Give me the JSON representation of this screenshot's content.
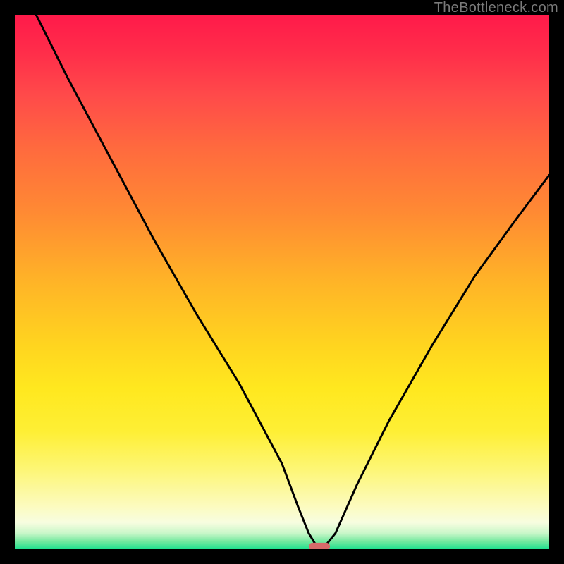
{
  "watermark": "TheBottleneck.com",
  "chart_data": {
    "type": "line",
    "title": "",
    "xlabel": "",
    "ylabel": "",
    "xlim": [
      0,
      100
    ],
    "ylim": [
      0,
      100
    ],
    "grid": false,
    "series": [
      {
        "name": "curve",
        "color": "#000000",
        "x": [
          4,
          10,
          18,
          26,
          34,
          42,
          50,
          53,
          55,
          56.5,
          58,
          60,
          64,
          70,
          78,
          86,
          94,
          100
        ],
        "y": [
          100,
          88,
          73,
          58,
          44,
          31,
          16,
          8,
          3,
          0.5,
          0.5,
          3,
          12,
          24,
          38,
          51,
          62,
          70
        ]
      }
    ],
    "marker": {
      "shape": "capsule",
      "color": "#d66a6a",
      "x": 57,
      "y": 0.5,
      "width": 4,
      "height": 1.4
    },
    "plot_background": {
      "type": "vertical-gradient",
      "stops": [
        {
          "pos": 0,
          "color": "#ff1a4a"
        },
        {
          "pos": 0.5,
          "color": "#ffb427"
        },
        {
          "pos": 0.85,
          "color": "#fdf675"
        },
        {
          "pos": 1.0,
          "color": "#1fe08f"
        }
      ]
    },
    "frame_color": "#000000"
  }
}
